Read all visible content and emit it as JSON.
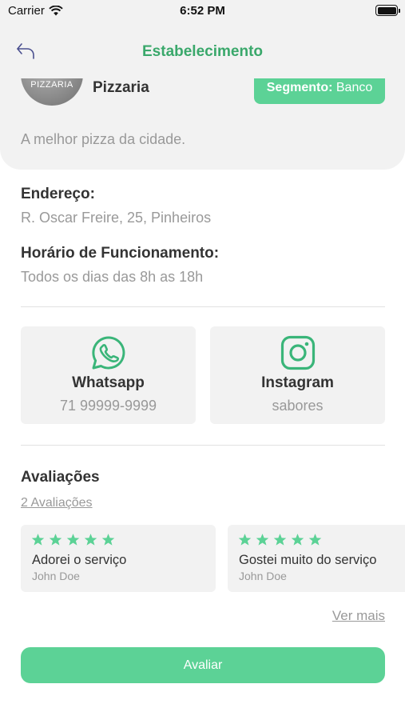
{
  "status_bar": {
    "carrier": "Carrier",
    "time": "6:52 PM"
  },
  "nav": {
    "title": "Estabelecimento",
    "back_icon": "back-arrow-icon"
  },
  "store": {
    "logo_text": "PIZZARIA",
    "name": "Pizzaria",
    "segment_label": "Segmento:",
    "segment_value": "Banco",
    "description": "A melhor pizza da cidade."
  },
  "address": {
    "label": "Endereço:",
    "value": "R. Oscar Freire, 25, Pinheiros"
  },
  "hours": {
    "label": "Horário de Funcionamento:",
    "value": "Todos os dias das 8h as 18h"
  },
  "contacts": [
    {
      "title": "Whatsapp",
      "value": "71 99999-9999",
      "icon": "whatsapp-icon"
    },
    {
      "title": "Instagram",
      "value": "sabores",
      "icon": "instagram-icon"
    }
  ],
  "reviews": {
    "title": "Avaliações",
    "count_link": "2 Avaliações",
    "items": [
      {
        "stars": 5,
        "text": "Adorei o serviço",
        "author": "John Doe"
      },
      {
        "stars": 5,
        "text": "Gostei muito do serviço",
        "author": "John Doe"
      }
    ],
    "see_more": "Ver mais"
  },
  "actions": {
    "rate_label": "Avaliar"
  },
  "colors": {
    "accent": "#5cd296",
    "title_green": "#3aa86b",
    "card_bg": "#f2f2f2"
  }
}
